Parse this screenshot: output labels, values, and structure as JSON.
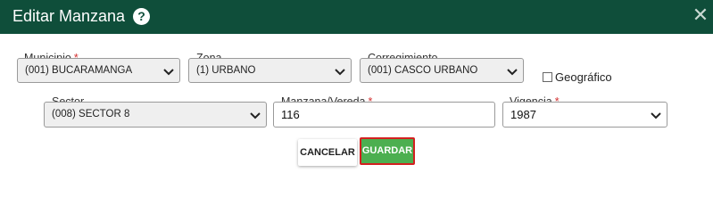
{
  "dialog": {
    "title": "Editar Manzana",
    "help_icon": "question-circle-icon",
    "close_icon": "close-icon"
  },
  "form": {
    "required_mark": "*",
    "municipio": {
      "label": "Municipio",
      "value": "(001) BUCARAMANGA",
      "required": true
    },
    "zona": {
      "label": "Zona",
      "value": "(1) URBANO",
      "required": false
    },
    "corregimiento": {
      "label": "Corregimiento",
      "value": "(001) CASCO URBANO",
      "required": false
    },
    "geografico": {
      "label": "Geográfico",
      "checked": false
    },
    "sector": {
      "label": "Sector",
      "value": "(008) SECTOR 8",
      "required": false
    },
    "manzana_vereda": {
      "label": "Manzana/Vereda",
      "value": "116",
      "required": true
    },
    "vigencia": {
      "label": "Vigencia",
      "value": "1987",
      "required": true
    }
  },
  "actions": {
    "cancel_label": "CANCELAR",
    "save_label": "GUARDAR"
  },
  "colors": {
    "header_bg": "#0f4e3a",
    "save_bg": "#4caf50",
    "save_border": "#d32020",
    "required": "#d32f2f"
  }
}
